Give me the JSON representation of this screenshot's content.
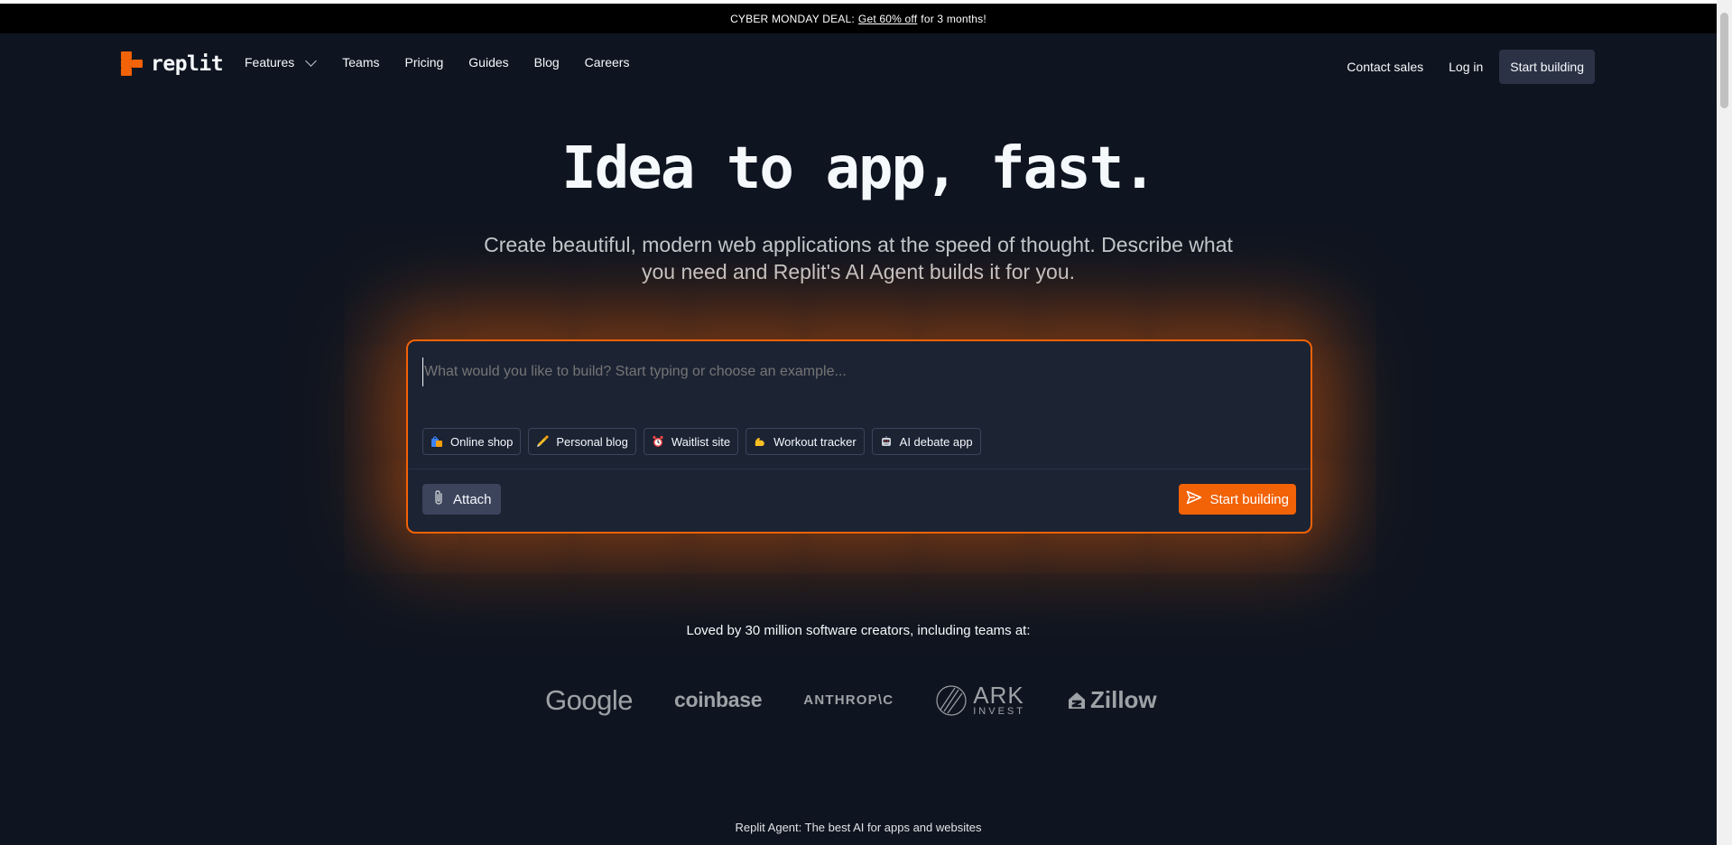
{
  "promo": {
    "prefix": "CYBER MONDAY DEAL:",
    "link": "Get 60% off",
    "suffix": "for 3 months!"
  },
  "brand": {
    "name": "replit",
    "accent": "#f26207"
  },
  "nav": {
    "links": [
      "Features",
      "Teams",
      "Pricing",
      "Guides",
      "Blog",
      "Careers"
    ],
    "contact_sales": "Contact sales",
    "login": "Log in",
    "start_building": "Start building"
  },
  "hero": {
    "title": "Idea to app, fast.",
    "subtitle": "Create beautiful, modern web applications at the speed of thought. Describe what you need and Replit's AI Agent builds it for you."
  },
  "prompt": {
    "placeholder": "What would you like to build? Start typing or choose an example...",
    "chips": [
      {
        "label": "Online shop",
        "icon": "shopping-bags-icon"
      },
      {
        "label": "Personal blog",
        "icon": "writing-hand-icon"
      },
      {
        "label": "Waitlist site",
        "icon": "alarm-clock-icon"
      },
      {
        "label": "Workout tracker",
        "icon": "flexed-biceps-icon"
      },
      {
        "label": "AI debate app",
        "icon": "robot-icon"
      }
    ],
    "attach_label": "Attach",
    "submit_label": "Start building"
  },
  "social_proof": {
    "text": "Loved by 30 million software creators, including teams at:",
    "companies": [
      "Google",
      "coinbase",
      "ANTHROP\\C",
      "ARK",
      "INVEST",
      "Zillow"
    ]
  },
  "footer_teaser": "Replit Agent: The best AI for apps and websites"
}
